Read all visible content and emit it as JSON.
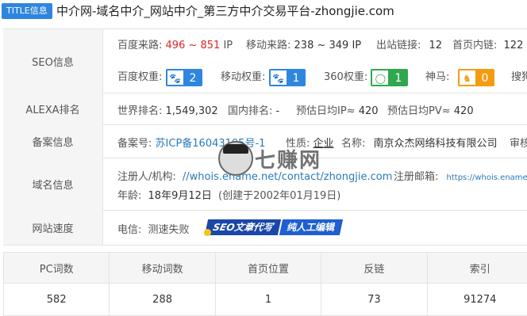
{
  "title": {
    "tag": "TITLE信息",
    "text": "中介网-域名中介_网站中介_第三方中介交易平台-zhongjie.com"
  },
  "seo": {
    "label": "SEO信息",
    "baidu_traffic_label": "百度来路:",
    "baidu_traffic_value": "496 ~ 851",
    "baidu_traffic_unit": "IP",
    "mobile_traffic_label": "移动来路:",
    "mobile_traffic_value": "238 ~ 349 IP",
    "outbound_label": "出站链接:",
    "outbound_value": "12",
    "inbound_label": "首页内链:",
    "inbound_value": "122",
    "baidu_weight_label": "百度权重:",
    "baidu_weight_value": "2",
    "mobile_weight_label": "移动权重:",
    "mobile_weight_value": "1",
    "w360_label": "360权重:",
    "w360_value": "1",
    "shenma_label": "神马:",
    "shenma_value": "0",
    "sogou_label": "搜狗"
  },
  "alexa": {
    "label": "ALEXA排名",
    "world_label": "世界排名:",
    "world_value": "1,549,302",
    "domestic_label": "国内排名:",
    "domestic_value": "-",
    "daily_ip_label": "预估日均IP≈",
    "daily_ip_value": "420",
    "daily_pv_label": "预估日均PV≈",
    "daily_pv_value": "420"
  },
  "icp": {
    "label": "备案信息",
    "number_label": "备案号:",
    "number_value": "苏ICP备16043105号-1",
    "nature_label": "性质:",
    "nature_value": "企业",
    "name_label": "名称:",
    "name_value": "南京众杰网络科技有限公司",
    "review_label": "审核"
  },
  "whois": {
    "label": "域名信息",
    "registrant_label": "注册人/机构:",
    "registrant_value": "//whois.ename.net/contact/zhongjie.com",
    "email_label": "注册邮箱:",
    "email_value": "https://whois.ename.n",
    "age_label": "年龄:",
    "age_value": "18年9月12日",
    "age_created": "(创建于2002年01月19日)"
  },
  "speed": {
    "label": "网站速度",
    "telecom_label": "电信:",
    "telecom_value": "测速失败"
  },
  "watermark": {
    "text": "七赚网"
  },
  "ad": {
    "left": "SEO文章代写",
    "right": "纯人工编辑"
  },
  "stats": {
    "headers": [
      "PC词数",
      "移动词数",
      "首页位置",
      "反链",
      "索引"
    ],
    "values": [
      "582",
      "288",
      "1",
      "73",
      "91274"
    ]
  },
  "colors": {
    "accent": "#2e86de",
    "red": "#e02424",
    "link": "#2a7ab8",
    "green": "#2fa84f",
    "orange": "#f39c12"
  }
}
